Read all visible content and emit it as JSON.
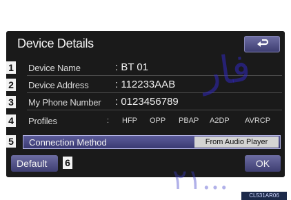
{
  "header": {
    "title": "Device Details"
  },
  "rows": [
    {
      "num": "1",
      "label": "Device Name",
      "value": ": BT 01"
    },
    {
      "num": "2",
      "label": "Device Address",
      "value": ": 112233AAB"
    },
    {
      "num": "3",
      "label": "My Phone Number",
      "value": ": 0123456789"
    }
  ],
  "profiles": {
    "num": "4",
    "label": "Profiles",
    "colon": ":",
    "items": [
      "HFP",
      "OPP",
      "PBAP",
      "A2DP",
      "AVRCP"
    ]
  },
  "connection": {
    "num": "5",
    "label": "Connection Method",
    "value": "From Audio Player"
  },
  "footer": {
    "default_label": "Default",
    "num": "6",
    "ok_label": "OK"
  },
  "watermark": {
    "text": "فار",
    "text2": "۲۱..."
  },
  "image_code": "CL531AR06"
}
